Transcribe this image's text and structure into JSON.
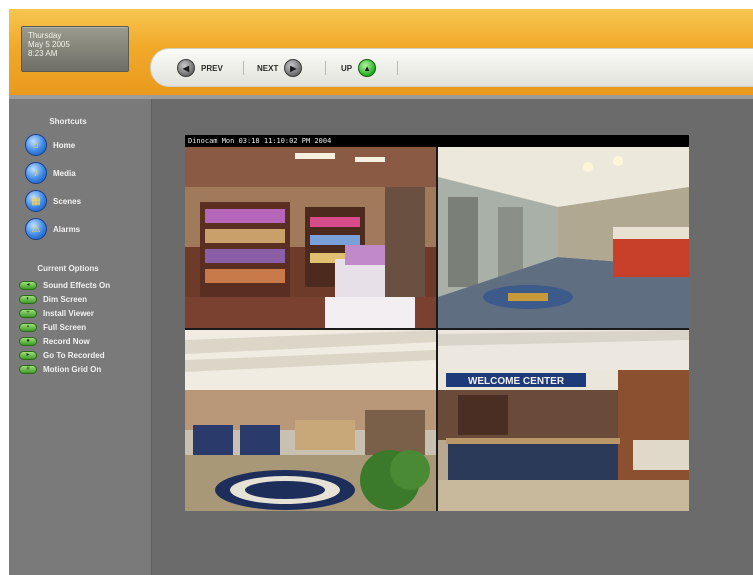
{
  "header": {
    "date": {
      "day": "Thursday",
      "date": "May 5 2005",
      "time": "8:23 AM"
    },
    "nav": {
      "prev_label": "PREV",
      "next_label": "NEXT",
      "up_label": "UP"
    }
  },
  "sidebar": {
    "shortcuts_title": "Shortcuts",
    "shortcuts": [
      {
        "label": "Home",
        "icon": "home-icon"
      },
      {
        "label": "Media",
        "icon": "speaker-icon"
      },
      {
        "label": "Scenes",
        "icon": "scenes-icon"
      },
      {
        "label": "Alarms",
        "icon": "alarm-icon"
      }
    ],
    "options_title": "Current Options",
    "options": [
      {
        "label": "Sound Effects On",
        "icon": "sound-icon"
      },
      {
        "label": "Dim Screen",
        "icon": "dim-icon"
      },
      {
        "label": "Install Viewer",
        "icon": "install-icon"
      },
      {
        "label": "Full Screen",
        "icon": "fullscreen-icon"
      },
      {
        "label": "Record Now",
        "icon": "record-icon"
      },
      {
        "label": "Go To Recorded",
        "icon": "recorded-icon"
      },
      {
        "label": "Motion Grid On",
        "icon": "motion-grid-icon"
      }
    ]
  },
  "viewer": {
    "caption": "Dinocam  Mon 03:18  11:10:02 PM  2004",
    "cameras": [
      {
        "name": "gift-shop"
      },
      {
        "name": "hallway"
      },
      {
        "name": "atrium"
      },
      {
        "name": "welcome-center",
        "sign_text": "WELCOME CENTER"
      }
    ]
  },
  "colors": {
    "header_orange": "#f1a92a",
    "panel_gray": "#6f6f6f",
    "accent_blue": "#3b86e4",
    "accent_green": "#3f9a27"
  }
}
